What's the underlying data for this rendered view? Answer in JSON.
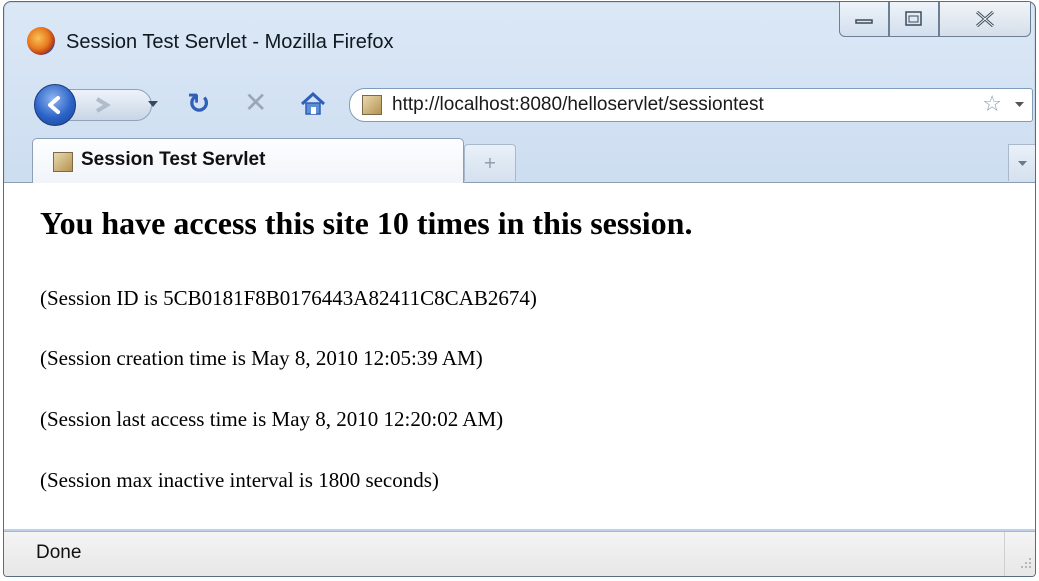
{
  "window": {
    "title": "Session Test Servlet - Mozilla Firefox",
    "caption_buttons": [
      "minimize-icon",
      "maximize-icon",
      "close-icon"
    ]
  },
  "navbar": {
    "url": "http://localhost:8080/helloservlet/sessiontest",
    "icons": [
      "back-icon",
      "forward-icon",
      "reload-icon",
      "stop-icon",
      "home-icon",
      "bookmark-star-icon"
    ]
  },
  "tabs": [
    {
      "label": "Session Test Servlet",
      "active": true
    }
  ],
  "page": {
    "heading": "You have access this site 10 times in this session.",
    "lines": [
      "(Session ID is 5CB0181F8B0176443A82411C8CAB2674)",
      "(Session creation time is May 8, 2010 12:05:39 AM)",
      "(Session last access time is May 8, 2010 12:20:02 AM)",
      "(Session max inactive interval is 1800 seconds)"
    ]
  },
  "status": {
    "text": "Done"
  },
  "colors": {
    "accent": "#2c63c8",
    "window_frame": "#c7d9ee"
  }
}
